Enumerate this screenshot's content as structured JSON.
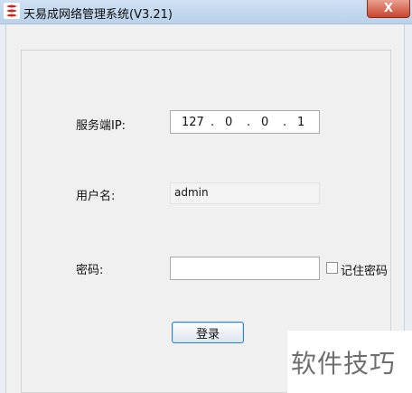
{
  "window": {
    "title": "天易成网络管理系统(V3.21)",
    "close_label": "X"
  },
  "form": {
    "server_ip_label": "服务端IP:",
    "server_ip": [
      "127",
      "0",
      "0",
      "1"
    ],
    "ip_separator": ".",
    "username_label": "用户名:",
    "username_value": "admin",
    "password_label": "密码:",
    "password_value": "",
    "remember_password_label": "记住密码",
    "remember_password_checked": false,
    "login_button_label": "登录"
  },
  "watermark": {
    "text": "软件技巧"
  },
  "colors": {
    "titlebar": "#b9d1ea",
    "close_button": "#c8452e",
    "button_border": "#3c7fb1"
  },
  "icons": {
    "app_icon": "app-logo-icon"
  }
}
